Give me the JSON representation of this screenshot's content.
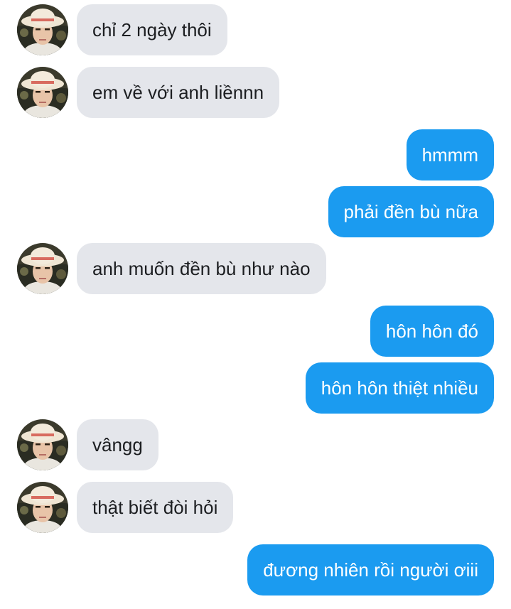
{
  "colors": {
    "incoming_bubble": "#e4e6eb",
    "outgoing_bubble": "#1b9bf0",
    "incoming_text": "#1c1e21",
    "outgoing_text": "#ffffff"
  },
  "avatar_icon": "contact-avatar-photo",
  "messages": [
    {
      "sender": "contact",
      "text": "chỉ 2 ngày thôi"
    },
    {
      "sender": "contact",
      "text": "em về với anh liềnnn"
    },
    {
      "sender": "me",
      "text": "hmmm"
    },
    {
      "sender": "me",
      "text": "phải đền bù nữa"
    },
    {
      "sender": "contact",
      "text": "anh muốn đền bù như nào"
    },
    {
      "sender": "me",
      "text": "hôn hôn đó"
    },
    {
      "sender": "me",
      "text": "hôn hôn thiệt nhiều"
    },
    {
      "sender": "contact",
      "text": "vângg"
    },
    {
      "sender": "contact",
      "text": "thật biết đòi hỏi"
    },
    {
      "sender": "me",
      "text": "đương nhiên rồi người ơiii"
    }
  ]
}
